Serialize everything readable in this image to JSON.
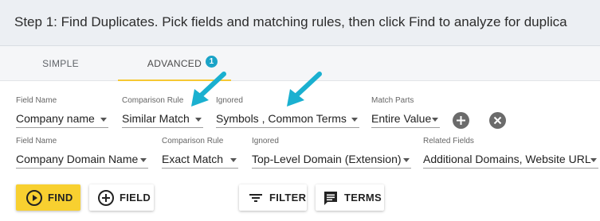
{
  "header": {
    "instructions": "Step 1: Find Duplicates. Pick fields and matching rules, then click Find to analyze for duplica"
  },
  "tabs": [
    {
      "label": "SIMPLE",
      "active": false
    },
    {
      "label": "ADVANCED",
      "active": true,
      "badge": "1"
    }
  ],
  "rows": [
    {
      "field_name_label": "Field Name",
      "field_name": "Company name",
      "comparison_rule_label": "Comparison Rule",
      "comparison_rule": "Similar Match",
      "ignored_label": "Ignored",
      "ignored": "Symbols , Common Terms",
      "match_parts_label": "Match Parts",
      "match_parts": "Entire Value"
    },
    {
      "field_name_label": "Field Name",
      "field_name": "Company Domain Name",
      "comparison_rule_label": "Comparison Rule",
      "comparison_rule": "Exact Match",
      "ignored_label": "Ignored",
      "ignored": "Top-Level Domain (Extension)",
      "related_fields_label": "Related Fields",
      "related_fields": "Additional Domains, Website URL"
    }
  ],
  "buttons": {
    "find": "FIND",
    "field": "FIELD",
    "filter": "FILTER",
    "terms": "TERMS"
  },
  "icons": {
    "add": "add-circle-icon",
    "remove": "close-circle-icon",
    "find": "play-circle-icon",
    "field": "add-circle-outline-icon",
    "filter": "filter-lines-icon",
    "terms": "message-box-icon",
    "callout": "arrow-pointer-icon"
  },
  "colors": {
    "accent_yellow": "#f8d030",
    "badge_blue": "#1aa3c7",
    "callout_arrow": "#1ab0d0",
    "header_bg": "#eceff3"
  }
}
